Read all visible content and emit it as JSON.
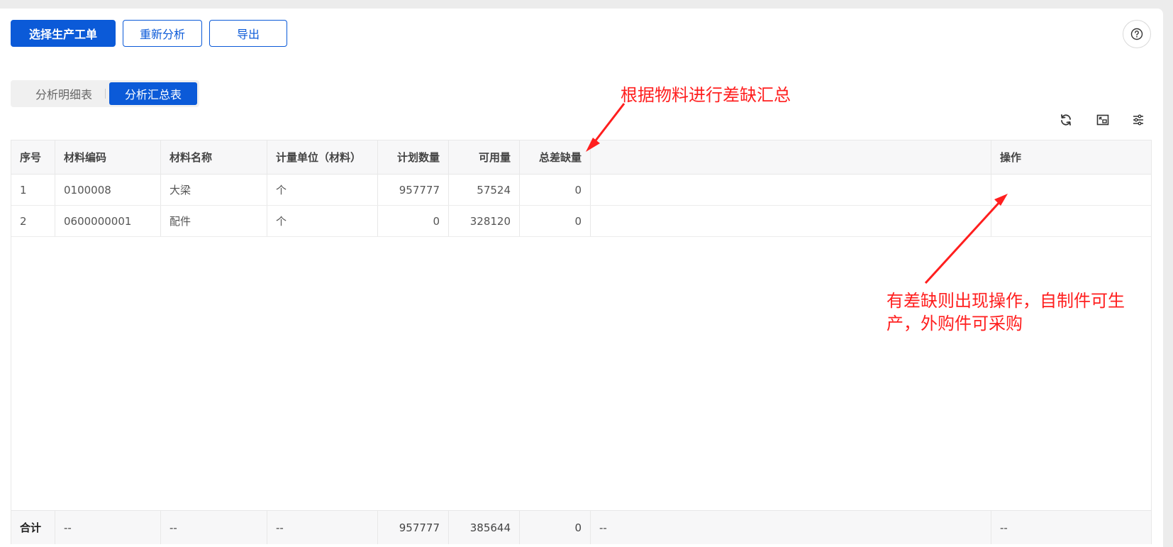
{
  "toolbar": {
    "select_order": "选择生产工单",
    "reanalyze": "重新分析",
    "export": "导出"
  },
  "tabs": {
    "detail": "分析明细表",
    "summary": "分析汇总表",
    "active": "summary"
  },
  "table": {
    "columns": [
      "序号",
      "材料编码",
      "材料名称",
      "计量单位（材料）",
      "计划数量",
      "可用量",
      "总差缺量",
      "",
      "操作"
    ],
    "rows": [
      {
        "seq": "1",
        "code": "0100008",
        "name": "大梁",
        "unit": "个",
        "plan": "957777",
        "avail": "57524",
        "short": "0",
        "blank": "",
        "op": ""
      },
      {
        "seq": "2",
        "code": "0600000001",
        "name": "配件",
        "unit": "个",
        "plan": "0",
        "avail": "328120",
        "short": "0",
        "blank": "",
        "op": ""
      }
    ],
    "footer": {
      "label": "合计",
      "code": "--",
      "name": "--",
      "unit": "--",
      "plan": "957777",
      "avail": "385644",
      "short": "0",
      "blank": "--",
      "op": "--"
    }
  },
  "annotations": {
    "shortage_summary": "根据物料进行差缺汇总",
    "operation_line1": "有差缺则出现操作，自制件可生",
    "operation_line2": "产，外购件可采购"
  },
  "colors": {
    "primary": "#0b5ad8",
    "annotation": "#ff1e1e"
  },
  "icons": [
    "help-icon",
    "refresh-icon",
    "fullscreen-icon",
    "settings-sliders-icon"
  ]
}
